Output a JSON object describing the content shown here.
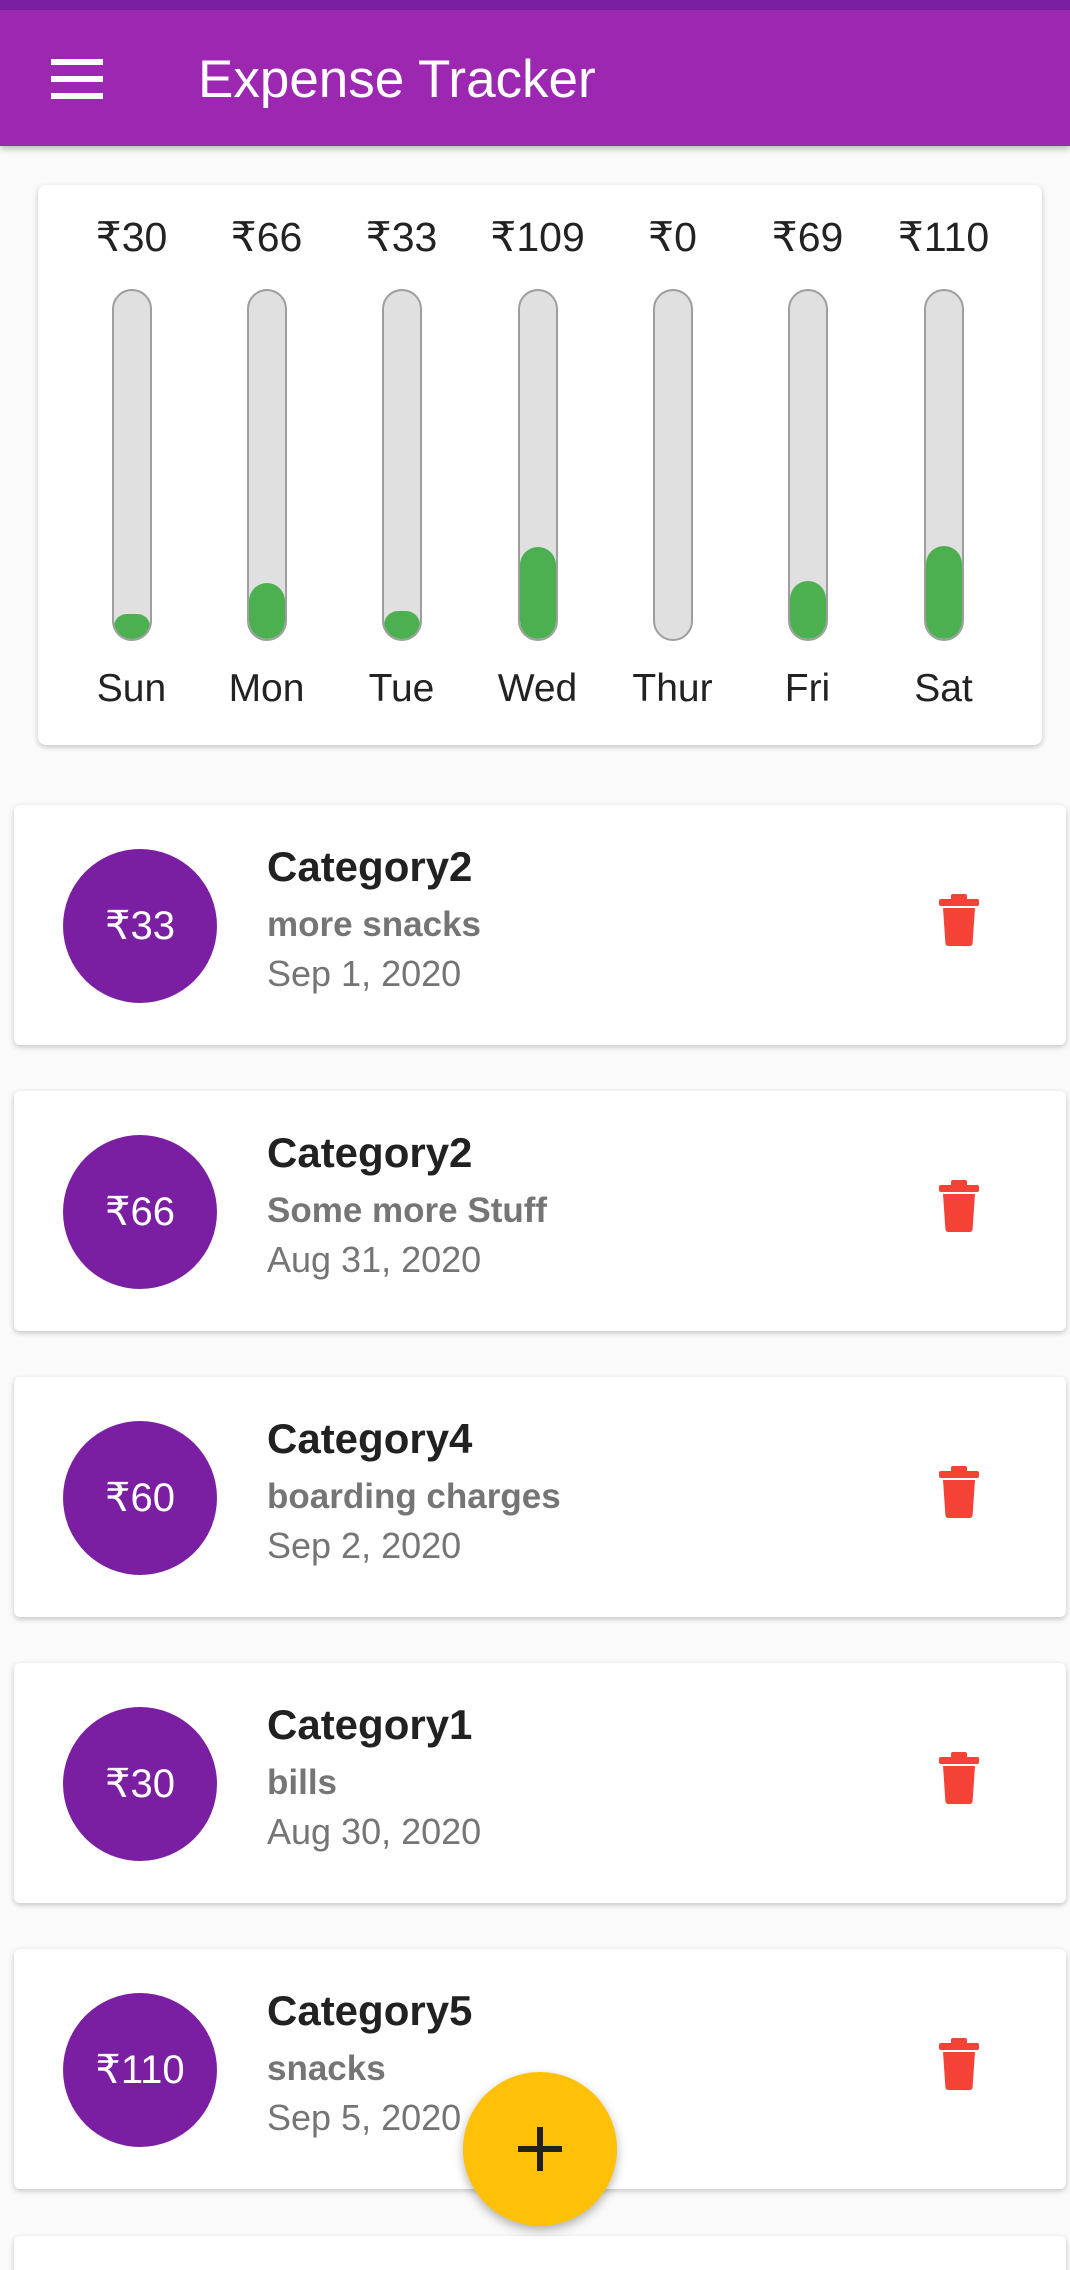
{
  "app": {
    "title": "Expense Tracker",
    "colors": {
      "primary": "#9c27b0",
      "primary_dark": "#7b1fa2",
      "bar_fill": "#4caf50",
      "bar_track": "#e0e0e0",
      "delete": "#f44336",
      "fab": "#ffc107"
    }
  },
  "appbar": {
    "menu_icon": "menu-icon"
  },
  "chart_data": {
    "type": "bar",
    "categories": [
      "Sun",
      "Mon",
      "Tue",
      "Wed",
      "Thur",
      "Fri",
      "Sat"
    ],
    "labels": [
      "₹30",
      "₹66",
      "₹33",
      "₹109",
      "₹0",
      "₹69",
      "₹110"
    ],
    "values": [
      30,
      66,
      33,
      109,
      0,
      69,
      110
    ],
    "fill_fraction": [
      0.073,
      0.16,
      0.08,
      0.264,
      0.0,
      0.167,
      0.266
    ]
  },
  "transactions": [
    {
      "amount": "₹33",
      "category": "Category2",
      "description": "more snacks",
      "date": "Sep 1, 2020"
    },
    {
      "amount": "₹66",
      "category": "Category2",
      "description": "Some more Stuff",
      "date": "Aug 31, 2020"
    },
    {
      "amount": "₹60",
      "category": "Category4",
      "description": "boarding charges",
      "date": "Sep 2, 2020"
    },
    {
      "amount": "₹30",
      "category": "Category1",
      "description": "bills",
      "date": "Aug 30, 2020"
    },
    {
      "amount": "₹110",
      "category": "Category5",
      "description": "snacks",
      "date": "Sep 5, 2020"
    }
  ],
  "fab": {
    "icon": "add-icon"
  }
}
